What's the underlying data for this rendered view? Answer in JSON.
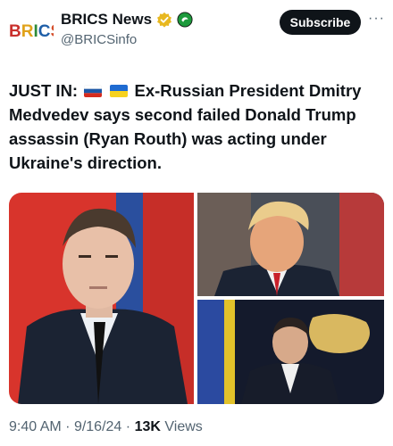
{
  "account": {
    "name": "BRICS News",
    "handle": "@BRICSinfo",
    "logo_text": "BRICS"
  },
  "actions": {
    "subscribe_label": "Subscribe",
    "more_label": "···"
  },
  "tweet": {
    "lead": "JUST IN:",
    "body": "Ex-Russian President Dmitry Medvedev says second failed Donald Trump assassin (Ryan Routh) was acting under Ukraine's direction."
  },
  "meta": {
    "time": "9:40 AM",
    "date": "9/16/24",
    "views_count": "13K",
    "views_label": "Views",
    "separator": "·"
  },
  "colors": {
    "verified_badge": "#e8b820",
    "affiliate_badge": "#1d9a3c",
    "text": "#0f1419",
    "muted": "#536471",
    "button": "#0f1419"
  }
}
